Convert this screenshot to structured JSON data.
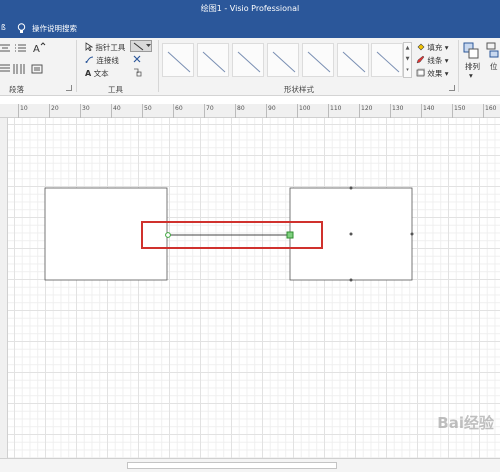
{
  "window": {
    "title": "绘图1  -  Visio Professional"
  },
  "tellme": {
    "fragment": "ß",
    "text": "操作说明搜索"
  },
  "ribbon": {
    "groups": {
      "paragraph": {
        "label": "段落"
      },
      "tools": {
        "label": "工具",
        "pointer_tool": "指针工具",
        "connector": "连接线",
        "text": "文本",
        "text_glyph": "A"
      },
      "shape_styles": {
        "label": "形状样式",
        "fill": "填充",
        "line": "线条",
        "effects": "效果"
      },
      "arrange": {
        "label": "排列",
        "position": "位"
      }
    }
  },
  "ruler": {
    "labels": [
      "10",
      "20",
      "30",
      "40",
      "50",
      "60",
      "70",
      "80",
      "90",
      "100",
      "110",
      "120",
      "130",
      "140",
      "150",
      "160"
    ]
  },
  "watermark": {
    "text": "Bai经验"
  },
  "colors": {
    "title_bar": "#2b579a",
    "highlight": "#d0312d",
    "handle_green": "#3aa63a"
  }
}
